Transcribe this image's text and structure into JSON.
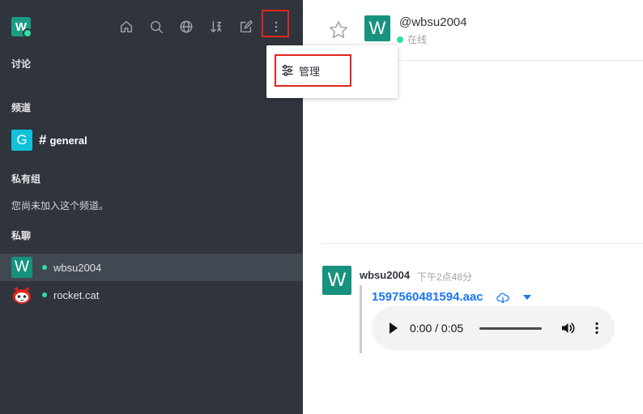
{
  "sidebar": {
    "logo_letter": "W",
    "sections": {
      "discussion": "讨论",
      "channels": "频道",
      "private_groups": "私有组",
      "private_groups_empty": "您尚未加入这个频道。",
      "direct_messages": "私聊"
    },
    "channel": {
      "avatar_letter": "G",
      "hash": "#",
      "name": "general"
    },
    "dms": [
      {
        "avatar_letter": "W",
        "name": "wbsu2004"
      },
      {
        "name": "rocket.cat"
      }
    ]
  },
  "menu": {
    "admin_label": "管理"
  },
  "header": {
    "avatar_letter": "W",
    "username": "@wbsu2004",
    "status": "在线"
  },
  "message": {
    "avatar_letter": "W",
    "author": "wbsu2004",
    "time": "下午2点48分",
    "file_name": "1597560481594.aac",
    "audio_time": "0:00 / 0:05"
  },
  "colors": {
    "sidebar_bg": "#2f343d",
    "accent": "#1d74f5",
    "online": "#2de0a5",
    "highlight": "#e0261d"
  }
}
